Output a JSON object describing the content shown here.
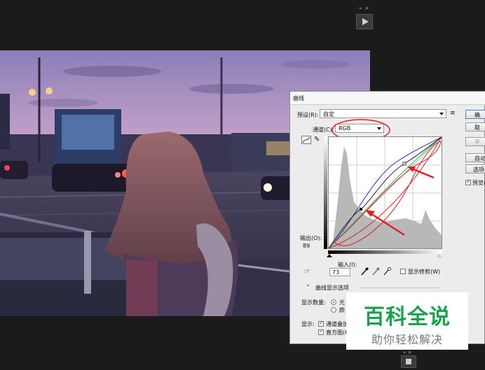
{
  "dialog": {
    "title": "曲线",
    "preset_label": "预设(R):",
    "preset_value": "自定",
    "channel_label": "通道(C):",
    "channel_value": "RGB",
    "output_label": "输出(O):",
    "output_value": "89",
    "input_label": "输入(I):",
    "input_value": "73",
    "show_clipping_label": "显示修剪(W)",
    "curve_options_label": "曲线显示选项",
    "show_amount_label": "显示数量:",
    "amount_option_light": "光",
    "amount_option_pigment": "颜",
    "show_label": "显示:",
    "show_channel_overlay": "通道叠加",
    "show_histogram": "直方图(H",
    "preview_label": "预览("
  },
  "buttons": {
    "ok": "确",
    "cancel": "取",
    "smooth": "平",
    "auto": "自动",
    "options": "选项("
  },
  "watermark": {
    "title": "百科全说",
    "subtitle": "助你轻松解决"
  },
  "colors": {
    "accent_red": "#e02020",
    "watermark_green": "#18a34a",
    "curve_blue": "#2030c0",
    "curve_red": "#e02020",
    "curve_green": "#20c040"
  },
  "icons": {
    "play": "play-icon",
    "curve_tool": "curve-tool-icon",
    "pencil": "pencil-icon",
    "hand": "hand-adjust-icon",
    "eyedropper_black": "eyedropper-black-icon",
    "eyedropper_gray": "eyedropper-gray-icon",
    "eyedropper_white": "eyedropper-white-icon",
    "preset_menu": "preset-menu-icon",
    "collapse": "collapse-icon"
  }
}
